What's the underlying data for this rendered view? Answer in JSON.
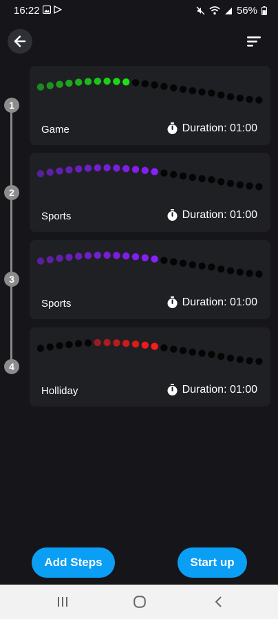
{
  "status": {
    "time": "16:22",
    "battery": "56%"
  },
  "steps": [
    {
      "number": "1",
      "name": "Game",
      "duration": "Duration: 01:00",
      "color": "#1ee01a"
    },
    {
      "number": "2",
      "name": "Sports",
      "duration": "Duration: 01:00",
      "color": "#8a1fff"
    },
    {
      "number": "3",
      "name": "Sports",
      "duration": "Duration: 01:00",
      "color": "#8a1fff"
    },
    {
      "number": "4",
      "name": "Holliday",
      "duration": "Duration: 01:00",
      "color": "#ff1a1a"
    }
  ],
  "buttons": {
    "add_steps": "Add Steps",
    "start_up": "Start up"
  },
  "colors": {
    "accent": "#0a9ff5",
    "background": "#15151a",
    "card": "#1f2024"
  }
}
